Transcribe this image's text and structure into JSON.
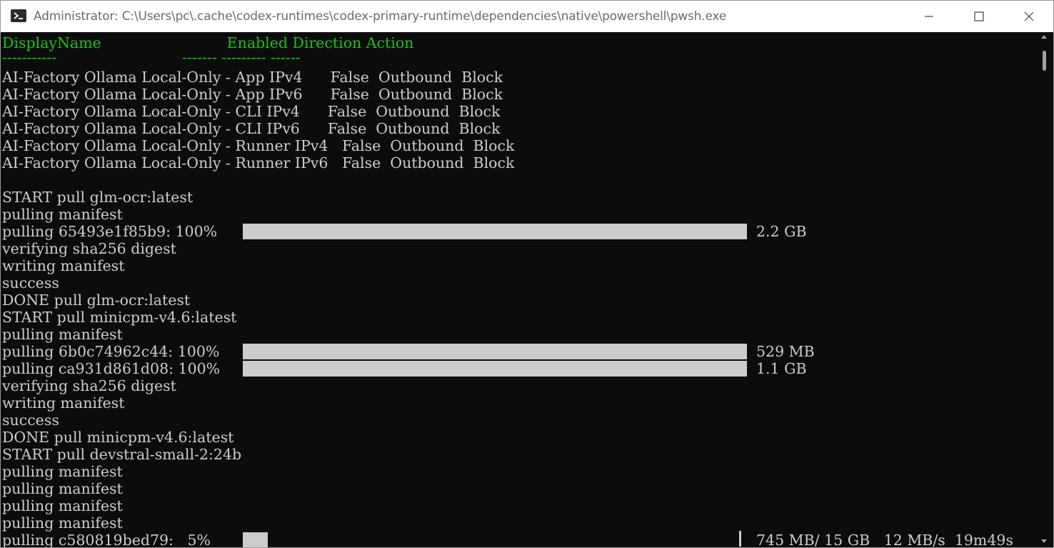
{
  "window": {
    "title": "Administrator: C:\\Users\\pc\\.cache\\codex-runtimes\\codex-primary-runtime\\dependencies\\native\\powershell\\pwsh.exe",
    "icon": "powershell-icon",
    "controls": [
      "minimize-icon",
      "maximize-icon",
      "close-icon"
    ]
  },
  "colors": {
    "terminal_bg": "#0c0c0c",
    "terminal_fg": "#cccccc",
    "header_green": "#16c60c",
    "progress_fill": "#cccccc"
  },
  "table": {
    "header": "DisplayName                           Enabled Direction Action",
    "separator": "-----------                           ------- --------- ------",
    "rows": [
      "AI-Factory Ollama Local-Only - App IPv4      False  Outbound  Block",
      "AI-Factory Ollama Local-Only - App IPv6      False  Outbound  Block",
      "AI-Factory Ollama Local-Only - CLI IPv4      False  Outbound  Block",
      "AI-Factory Ollama Local-Only - CLI IPv6      False  Outbound  Block",
      "AI-Factory Ollama Local-Only - Runner IPv4   False  Outbound  Block",
      "AI-Factory Ollama Local-Only - Runner IPv6   False  Outbound  Block"
    ]
  },
  "log": {
    "l1": "START pull glm-ocr:latest",
    "l2": "pulling manifest",
    "l3": "pulling 65493e1f85b9: 100%",
    "l3_size": "2.2 GB",
    "l3_progress": 1.0,
    "l4": "verifying sha256 digest",
    "l5": "writing manifest",
    "l6": "success",
    "l7": "DONE pull glm-ocr:latest",
    "l8": "START pull minicpm-v4.6:latest",
    "l9": "pulling manifest",
    "l10": "pulling 6b0c74962c44: 100%",
    "l10_size": "529 MB",
    "l10_progress": 1.0,
    "l11": "pulling ca931d861d08: 100%",
    "l11_size": "1.1 GB",
    "l11_progress": 1.0,
    "l12": "verifying sha256 digest",
    "l13": "writing manifest",
    "l14": "success",
    "l15": "DONE pull minicpm-v4.6:latest",
    "l16": "START pull devstral-small-2:24b",
    "l17": "pulling manifest",
    "l18": "pulling manifest",
    "l19": "pulling manifest",
    "l20": "pulling manifest",
    "l21": "pulling c580819bed79:   5%",
    "l21_stats": "745 MB/ 15 GB   12 MB/s  19m49s",
    "l21_progress": 0.05
  }
}
